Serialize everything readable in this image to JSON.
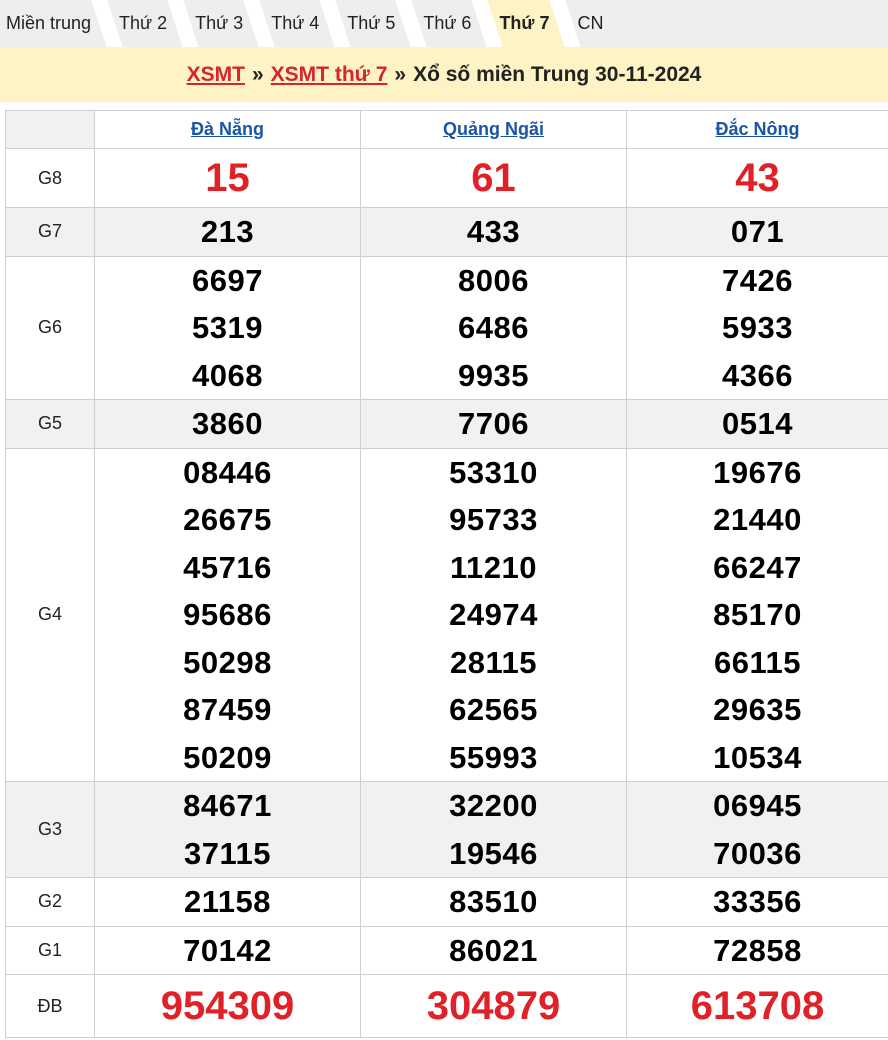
{
  "tabs": [
    {
      "label": "Miền trung",
      "active": false
    },
    {
      "label": "Thứ 2",
      "active": false
    },
    {
      "label": "Thứ 3",
      "active": false
    },
    {
      "label": "Thứ 4",
      "active": false
    },
    {
      "label": "Thứ 5",
      "active": false
    },
    {
      "label": "Thứ 6",
      "active": false
    },
    {
      "label": "Thứ 7",
      "active": true
    },
    {
      "label": "CN",
      "active": false
    }
  ],
  "banner": {
    "link1": "XSMT",
    "sep": "»",
    "link2": "XSMT thứ 7",
    "title": "Xổ số miền Trung 30-11-2024"
  },
  "provinces": [
    "Đà Nẵng",
    "Quảng Ngãi",
    "Đắc Nông"
  ],
  "prizes": [
    {
      "label": "G8",
      "values": [
        [
          "15"
        ],
        [
          "61"
        ],
        [
          "43"
        ]
      ]
    },
    {
      "label": "G7",
      "values": [
        [
          "213"
        ],
        [
          "433"
        ],
        [
          "071"
        ]
      ]
    },
    {
      "label": "G6",
      "values": [
        [
          "6697",
          "5319",
          "4068"
        ],
        [
          "8006",
          "6486",
          "9935"
        ],
        [
          "7426",
          "5933",
          "4366"
        ]
      ]
    },
    {
      "label": "G5",
      "values": [
        [
          "3860"
        ],
        [
          "7706"
        ],
        [
          "0514"
        ]
      ]
    },
    {
      "label": "G4",
      "values": [
        [
          "08446",
          "26675",
          "45716",
          "95686",
          "50298",
          "87459",
          "50209"
        ],
        [
          "53310",
          "95733",
          "11210",
          "24974",
          "28115",
          "62565",
          "55993"
        ],
        [
          "19676",
          "21440",
          "66247",
          "85170",
          "66115",
          "29635",
          "10534"
        ]
      ]
    },
    {
      "label": "G3",
      "values": [
        [
          "84671",
          "37115"
        ],
        [
          "32200",
          "19546"
        ],
        [
          "06945",
          "70036"
        ]
      ]
    },
    {
      "label": "G2",
      "values": [
        [
          "21158"
        ],
        [
          "83510"
        ],
        [
          "33356"
        ]
      ]
    },
    {
      "label": "G1",
      "values": [
        [
          "70142"
        ],
        [
          "86021"
        ],
        [
          "72858"
        ]
      ]
    },
    {
      "label": "ĐB",
      "values": [
        [
          "954309"
        ],
        [
          "304879"
        ],
        [
          "613708"
        ]
      ]
    }
  ],
  "colors": {
    "accent_red": "#e02127",
    "link_blue": "#1a55a6",
    "banner_bg": "#fdf3c4"
  }
}
